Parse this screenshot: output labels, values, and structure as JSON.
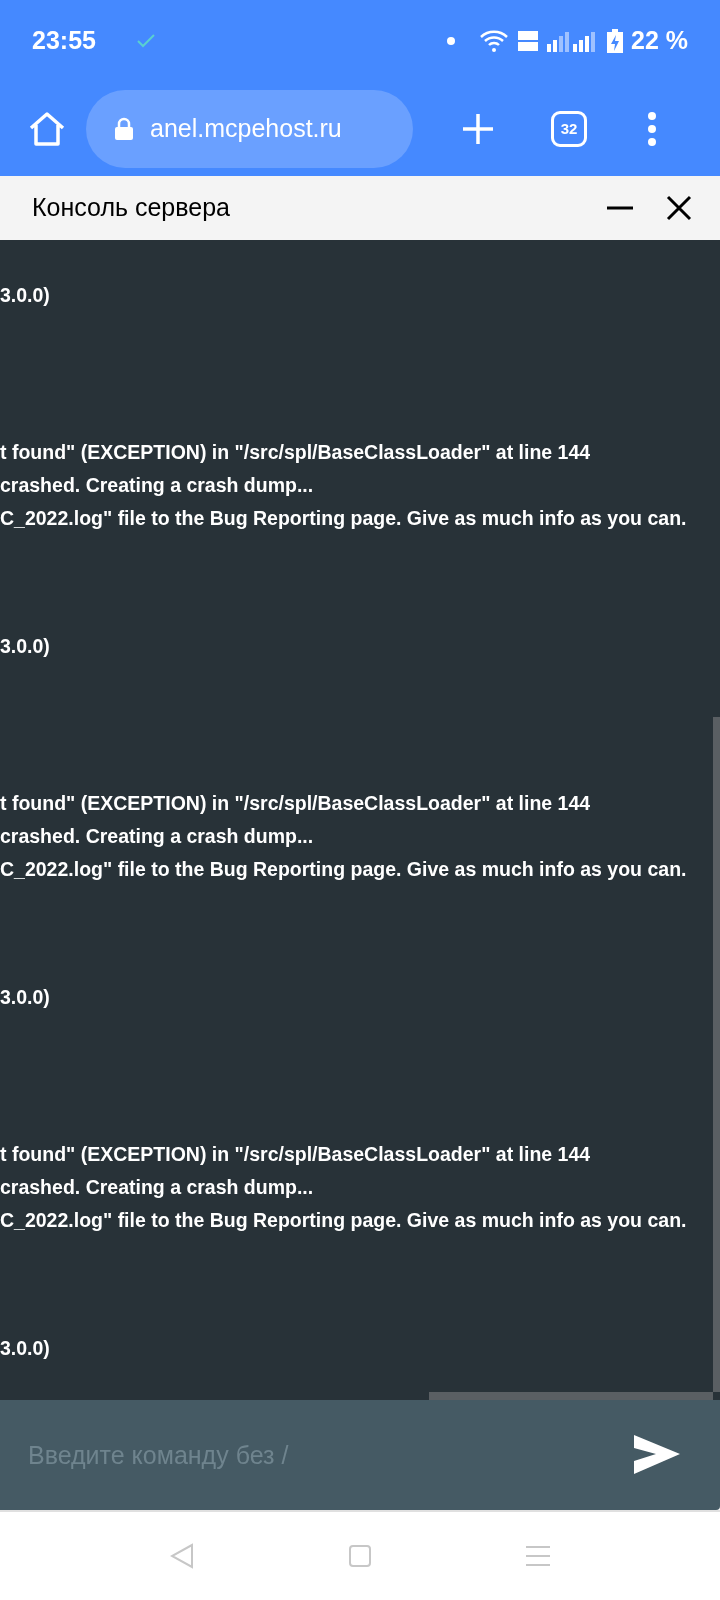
{
  "status_bar": {
    "time": "23:55",
    "battery": "22 %"
  },
  "browser": {
    "url": "anel.mcpehost.ru",
    "tab_count": "32"
  },
  "panel": {
    "title": "Консоль сервера"
  },
  "console": {
    "blocks": [
      {
        "version": "3.0.0)",
        "errors": [
          "t found\" (EXCEPTION) in \"/src/spl/BaseClassLoader\" at line 144",
          "crashed. Creating a crash dump...",
          "C_2022.log\" file to the Bug Reporting page. Give as much info as you can."
        ]
      },
      {
        "version": "3.0.0)",
        "errors": [
          "t found\" (EXCEPTION) in \"/src/spl/BaseClassLoader\" at line 144",
          "crashed. Creating a crash dump...",
          "C_2022.log\" file to the Bug Reporting page. Give as much info as you can."
        ]
      },
      {
        "version": "3.0.0)",
        "errors": [
          "t found\" (EXCEPTION) in \"/src/spl/BaseClassLoader\" at line 144",
          "crashed. Creating a crash dump...",
          "C_2022.log\" file to the Bug Reporting page. Give as much info as you can."
        ]
      },
      {
        "version": "3.0.0)"
      }
    ]
  },
  "command": {
    "placeholder": "Введите команду без /"
  }
}
